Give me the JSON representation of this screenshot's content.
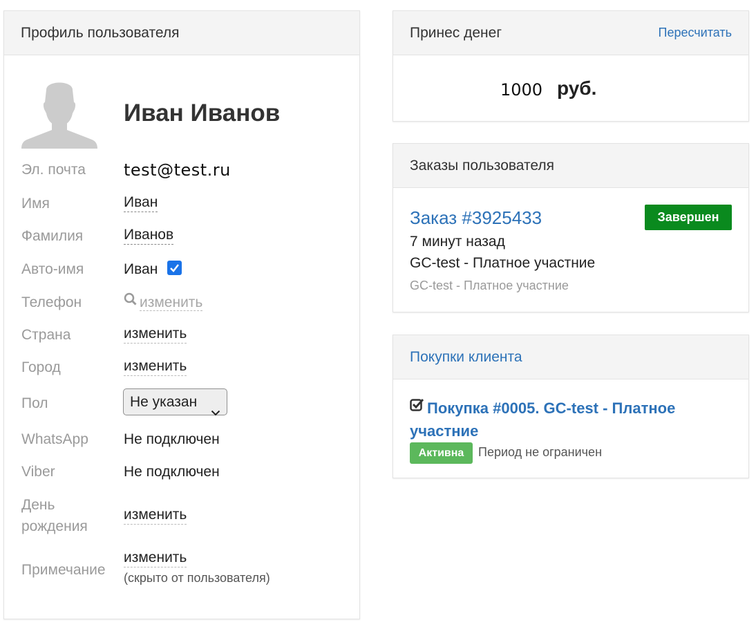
{
  "profile": {
    "header": "Профиль пользователя",
    "name": "Иван Иванов",
    "fields": {
      "email": {
        "label": "Эл. почта",
        "value": "test@test.ru"
      },
      "first_name": {
        "label": "Имя",
        "value": "Иван"
      },
      "last_name": {
        "label": "Фамилия",
        "value": "Иванов"
      },
      "auto_name": {
        "label": "Авто-имя",
        "value": "Иван",
        "checked": true
      },
      "phone": {
        "label": "Телефон",
        "action": "изменить",
        "icon": "search-icon"
      },
      "country": {
        "label": "Страна",
        "action": "изменить"
      },
      "city": {
        "label": "Город",
        "action": "изменить"
      },
      "gender": {
        "label": "Пол",
        "selected": "Не указан"
      },
      "whatsapp": {
        "label": "WhatsApp",
        "value": "Не подключен"
      },
      "viber": {
        "label": "Viber",
        "value": "Не подключен"
      },
      "birthday": {
        "label_line1": "День",
        "label_line2": "рождения",
        "action": "изменить"
      },
      "note": {
        "label": "Примечание",
        "action": "изменить",
        "hint": "(скрыто от пользователя)"
      }
    }
  },
  "money": {
    "header": "Принес денег",
    "recalc_label": "Пересчитать",
    "amount": "1000",
    "currency": "руб."
  },
  "orders": {
    "header": "Заказы пользователя",
    "items": [
      {
        "link": "Заказ #3925433",
        "status": "Завершен",
        "status_color": "#0a8a1e",
        "time": "7 минут назад",
        "title": "GC-test - Платное участние",
        "subtitle": "GC-test - Платное участние"
      }
    ]
  },
  "purchases": {
    "header": "Покупки клиента",
    "items": [
      {
        "icon": "checkbox-checked-icon",
        "link": "Покупка #0005. GC-test - Платное участние",
        "status": "Активна",
        "status_color": "#5cb85c",
        "period": "Период не ограничен"
      }
    ]
  },
  "colors": {
    "link": "#2d72b8",
    "label": "#9a9a9a",
    "checkbox": "#1a73e8"
  }
}
